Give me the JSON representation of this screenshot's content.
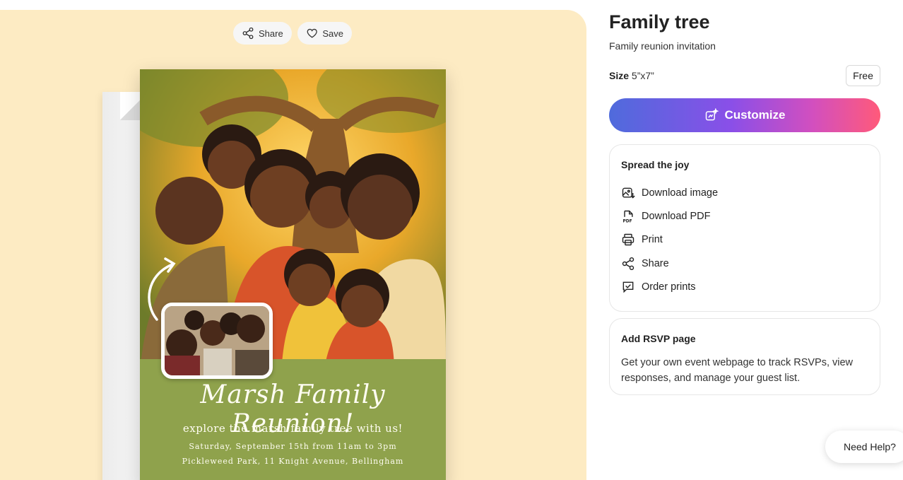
{
  "toolbar": {
    "share_label": "Share",
    "save_label": "Save"
  },
  "card": {
    "title": "Marsh Family Reunion!",
    "subtitle": "explore the marsh family tree with us!",
    "date_line": "Saturday, September 15th from 11am to 3pm",
    "location_line": "Pickleweed Park, 11 Knight Avenue, Bellingham"
  },
  "product": {
    "title": "Family tree",
    "subtitle": "Family reunion invitation",
    "size_label": "Size",
    "size_value": "5”x7”",
    "price_badge": "Free",
    "customize_label": "Customize"
  },
  "spread": {
    "title": "Spread the joy",
    "actions": [
      {
        "label": "Download image",
        "icon": "image-download-icon"
      },
      {
        "label": "Download PDF",
        "icon": "pdf-icon"
      },
      {
        "label": "Print",
        "icon": "printer-icon"
      },
      {
        "label": "Share",
        "icon": "share-icon"
      },
      {
        "label": "Order prints",
        "icon": "order-prints-icon"
      }
    ]
  },
  "rsvp": {
    "title": "Add RSVP page",
    "description": "Get your own event webpage to track RSVPs, view responses, and manage your guest list."
  },
  "help": {
    "label": "Need Help?"
  }
}
